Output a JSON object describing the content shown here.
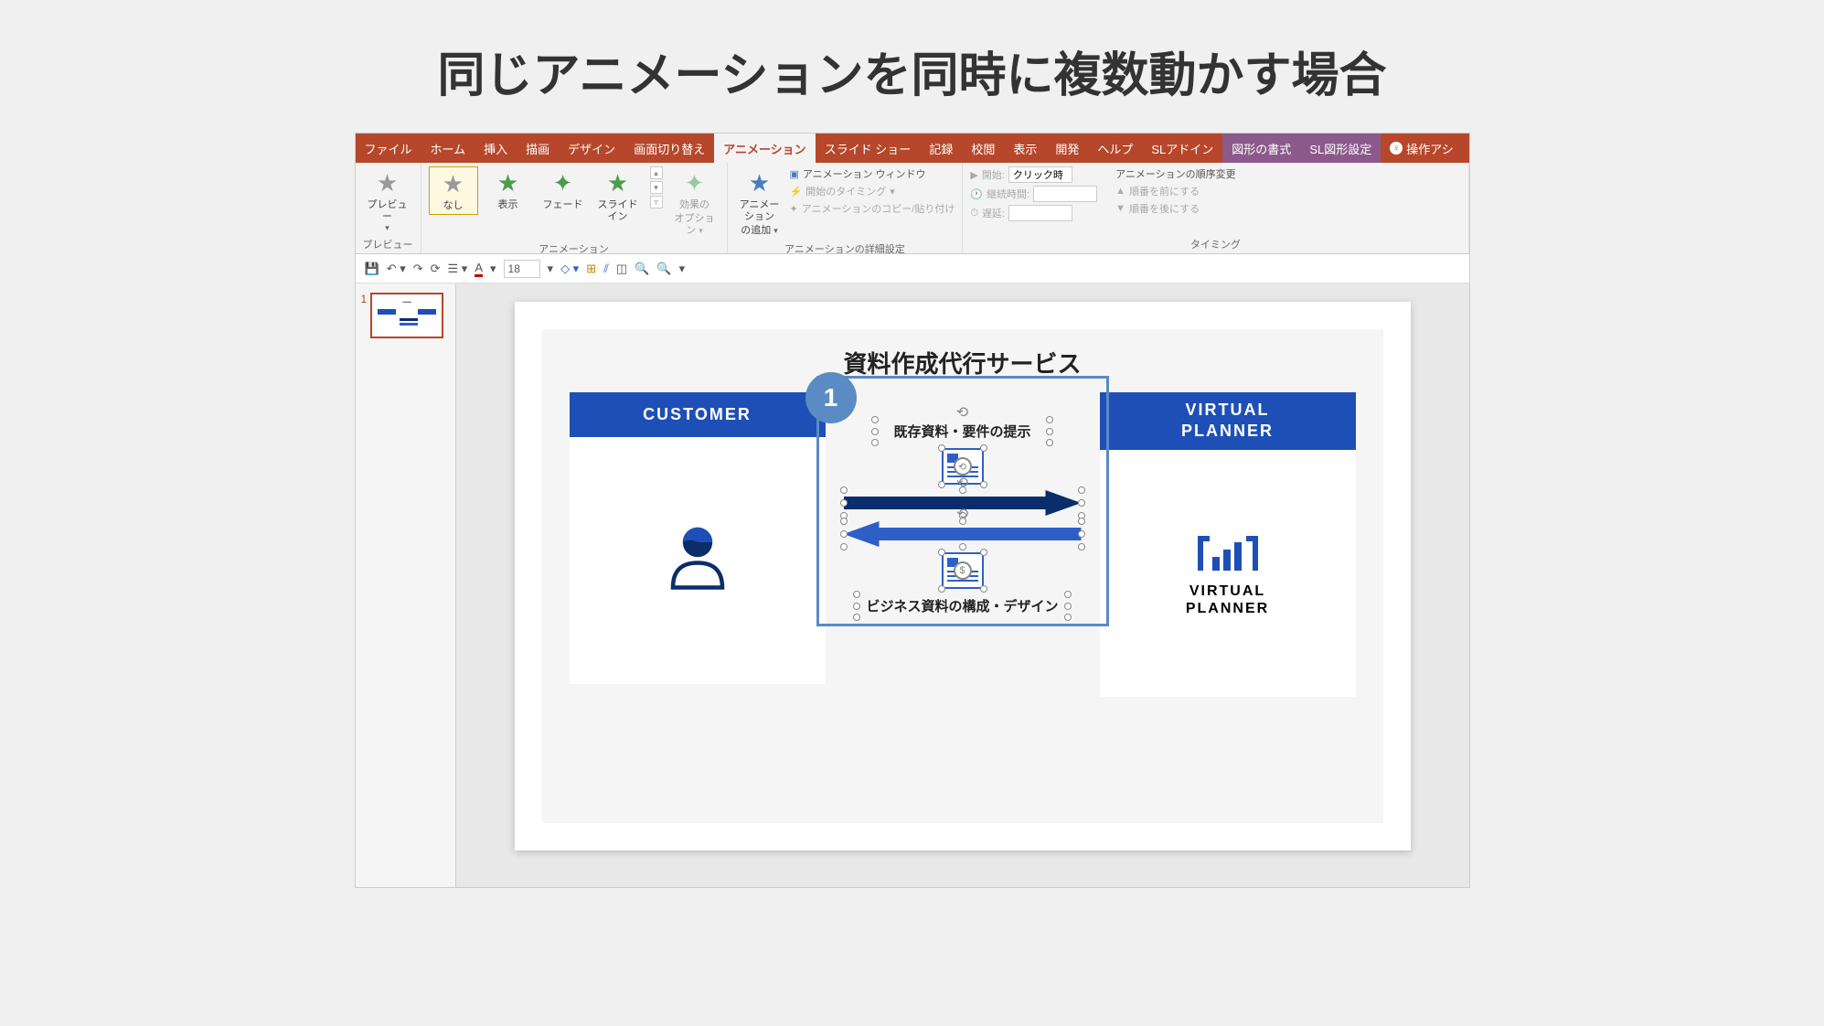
{
  "page_title": "同じアニメーションを同時に複数動かす場合",
  "tabs": {
    "file": "ファイル",
    "home": "ホーム",
    "insert": "挿入",
    "draw": "描画",
    "design": "デザイン",
    "transitions": "画面切り替え",
    "animations": "アニメーション",
    "slideshow": "スライド ショー",
    "record": "記録",
    "review": "校閲",
    "view": "表示",
    "developer": "開発",
    "help": "ヘルプ",
    "sladdin": "SLアドイン",
    "shape_format": "図形の書式",
    "sl_shape": "SL図形設定",
    "tell_me": "操作アシ"
  },
  "ribbon": {
    "preview": {
      "label": "プレビュー",
      "group": "プレビュー"
    },
    "gallery": {
      "none": "なし",
      "appear": "表示",
      "fade": "フェード",
      "slidein": "スライドイン",
      "group": "アニメーション"
    },
    "effect_options": {
      "label1": "効果の",
      "label2": "オプション"
    },
    "add_animation": {
      "label1": "アニメーション",
      "label2": "の追加"
    },
    "advanced": {
      "pane": "アニメーション ウィンドウ",
      "trigger": "開始のタイミング",
      "painter": "アニメーションのコピー/貼り付け",
      "group": "アニメーションの詳細設定"
    },
    "timing": {
      "start_label": "開始:",
      "start_value": "クリック時",
      "duration_label": "継続時間:",
      "delay_label": "遅延:",
      "reorder": "アニメーションの順序変更",
      "move_earlier": "順番を前にする",
      "move_later": "順番を後にする",
      "group": "タイミング"
    }
  },
  "qat": {
    "font_size": "18"
  },
  "thumb": {
    "num": "1"
  },
  "slide": {
    "title": "資料作成代行サービス",
    "customer": "CUSTOMER",
    "vp1": "VIRTUAL",
    "vp2": "PLANNER",
    "step": "1",
    "mid_top": "既存資料・要件の提示",
    "mid_bottom": "ビジネス資料の構成・デザイン",
    "logo1": "VIRTUAL",
    "logo2": "PLANNER"
  }
}
